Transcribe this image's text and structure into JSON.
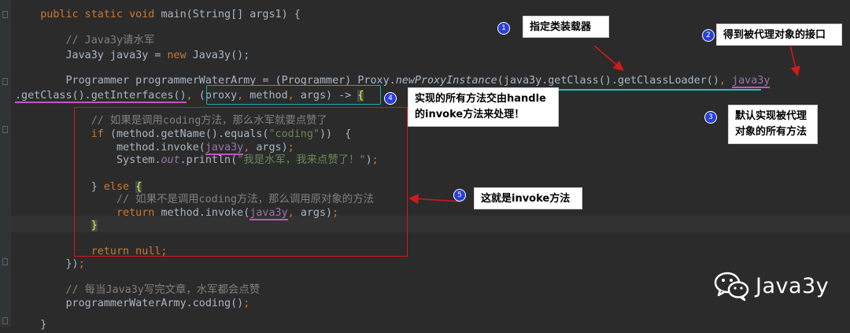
{
  "editor": {
    "lines": [
      {
        "id": "l1",
        "segments": [
          [
            "",
            "    "
          ],
          [
            "kw",
            "public static void "
          ],
          [
            "",
            "main(String[] args1) {"
          ]
        ]
      },
      {
        "id": "l2",
        "segments": [
          [
            "",
            "        "
          ],
          [
            "cm",
            "// Java3y请水军"
          ]
        ]
      },
      {
        "id": "l3",
        "segments": [
          [
            "",
            "        Java3y java3y = "
          ],
          [
            "kw",
            "new "
          ],
          [
            "",
            "Java3y();"
          ]
        ]
      },
      {
        "id": "l4",
        "segments": [
          [
            "",
            "        Programmer programmerWaterArmy = (Programmer) Proxy."
          ],
          [
            "it",
            "newProxyInstance"
          ],
          [
            "",
            "(java3y.getClass().getClassLoader()"
          ],
          [
            "kw",
            ", "
          ],
          [
            "ulfld",
            "java3y"
          ]
        ]
      },
      {
        "id": "l5",
        "segments": [
          [
            "ul",
            ".getClass().getInterfaces()"
          ],
          [
            "kw",
            ", "
          ],
          [
            "",
            "(proxy"
          ],
          [
            "kw",
            ", "
          ],
          [
            "",
            "method"
          ],
          [
            "kw",
            ", "
          ],
          [
            "",
            "args) -> "
          ],
          [
            "brace",
            "{"
          ]
        ]
      },
      {
        "id": "l6",
        "segments": [
          [
            "",
            "            "
          ],
          [
            "cm",
            "// 如果是调用coding方法，那么水军就要点赞了"
          ]
        ]
      },
      {
        "id": "l7",
        "segments": [
          [
            "",
            "            "
          ],
          [
            "kw",
            "if "
          ],
          [
            "",
            "(method.getName().equals("
          ],
          [
            "str",
            "\"coding\""
          ],
          [
            "",
            "))  {"
          ]
        ]
      },
      {
        "id": "l8",
        "segments": [
          [
            "",
            "                method.invoke("
          ],
          [
            "ulfld",
            "java3y"
          ],
          [
            "kw",
            ", "
          ],
          [
            "",
            "args)"
          ],
          [
            "kw",
            ";"
          ]
        ]
      },
      {
        "id": "l9",
        "segments": [
          [
            "",
            "                System."
          ],
          [
            "fldit",
            "out"
          ],
          [
            "",
            ".println("
          ],
          [
            "str",
            "\"我是水军，我来点赞了！\""
          ],
          [
            "",
            ")"
          ],
          [
            "kw",
            ";"
          ]
        ]
      },
      {
        "id": "l10",
        "segments": [
          [
            "",
            "            } "
          ],
          [
            "kw",
            "else "
          ],
          [
            "brace",
            "{"
          ]
        ]
      },
      {
        "id": "l11",
        "segments": [
          [
            "",
            "                "
          ],
          [
            "cm",
            "// 如果不是调用coding方法，那么调用原对象的方法"
          ]
        ]
      },
      {
        "id": "l12",
        "segments": [
          [
            "",
            "                "
          ],
          [
            "kw",
            "return "
          ],
          [
            "",
            "method.invoke("
          ],
          [
            "ulfld",
            "java3y"
          ],
          [
            "kw",
            ", "
          ],
          [
            "",
            "args)"
          ],
          [
            "kw",
            ";"
          ]
        ]
      },
      {
        "id": "l13",
        "segments": [
          [
            "",
            "            "
          ],
          [
            "brace",
            "}"
          ]
        ]
      },
      {
        "id": "l14",
        "segments": [
          [
            "",
            "            "
          ],
          [
            "kw",
            "return null;"
          ]
        ]
      },
      {
        "id": "l15",
        "segments": [
          [
            "",
            "        })"
          ],
          [
            "kw",
            ";"
          ]
        ]
      },
      {
        "id": "l16",
        "segments": [
          [
            "",
            "        "
          ],
          [
            "cm",
            "// 每当Java3y写完文章，水军都会点赞"
          ]
        ]
      },
      {
        "id": "l17",
        "segments": [
          [
            "",
            "        programmerWaterArmy.coding()"
          ],
          [
            "kw",
            ";"
          ]
        ]
      },
      {
        "id": "l18",
        "segments": [
          [
            "",
            "    }"
          ]
        ]
      }
    ]
  },
  "annotations": {
    "c1": {
      "badge": "1",
      "text": "指定类装载器"
    },
    "c2": {
      "badge": "2",
      "text": "得到被代理对象的接口"
    },
    "c3": {
      "badge": "3",
      "text": "默认实现被代理对象的所有方法"
    },
    "c4": {
      "badge": "4",
      "text": "实现的所有方法交由handle的invoke方法来处理！"
    },
    "c5": {
      "badge": "5",
      "text": "这就是invoke方法"
    }
  },
  "watermark": {
    "icon": "wechat-icon",
    "text": "Java3y"
  },
  "colors": {
    "background": "#2b2b2b",
    "keyword": "#cc7832",
    "comment": "#808080",
    "string": "#6a8759",
    "field": "#9876aa",
    "text": "#a9b7c6",
    "annotation_red": "#d11a1a",
    "badge_blue": "#2a3fd8"
  }
}
